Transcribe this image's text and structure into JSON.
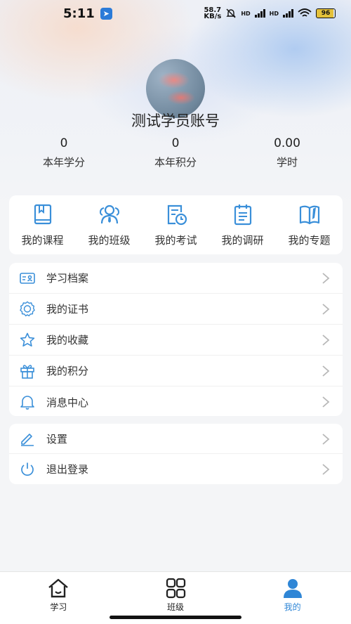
{
  "status_bar": {
    "time": "5:11",
    "net_speed_value": "58.7",
    "net_speed_unit": "KB/s",
    "signal_label_1": "HD",
    "signal_label_2": "HD",
    "battery": "96"
  },
  "profile": {
    "username": "测试学员账号",
    "stats": [
      {
        "value": "0",
        "label": "本年学分"
      },
      {
        "value": "0",
        "label": "本年积分"
      },
      {
        "value": "0.00",
        "label": "学时"
      }
    ]
  },
  "quick_actions": [
    {
      "label": "我的课程",
      "icon": "book-icon"
    },
    {
      "label": "我的班级",
      "icon": "class-group-icon"
    },
    {
      "label": "我的考试",
      "icon": "exam-clock-icon"
    },
    {
      "label": "我的调研",
      "icon": "survey-clipboard-icon"
    },
    {
      "label": "我的专题",
      "icon": "topic-book-icon"
    }
  ],
  "menu_primary": [
    {
      "label": "学习档案",
      "icon": "profile-card-icon"
    },
    {
      "label": "我的证书",
      "icon": "certificate-badge-icon"
    },
    {
      "label": "我的收藏",
      "icon": "star-icon"
    },
    {
      "label": "我的积分",
      "icon": "gift-icon"
    },
    {
      "label": "消息中心",
      "icon": "bell-icon"
    }
  ],
  "menu_secondary": [
    {
      "label": "设置",
      "icon": "pen-icon"
    },
    {
      "label": "退出登录",
      "icon": "power-icon"
    }
  ],
  "tabs": [
    {
      "label": "学习",
      "icon": "home-icon",
      "active": false
    },
    {
      "label": "班级",
      "icon": "grid-icon",
      "active": false
    },
    {
      "label": "我的",
      "icon": "user-icon",
      "active": true
    }
  ],
  "colors": {
    "accent": "#2f86d6",
    "icon_blue": "#3a8fd9",
    "chevron": "#b8b8b8"
  }
}
